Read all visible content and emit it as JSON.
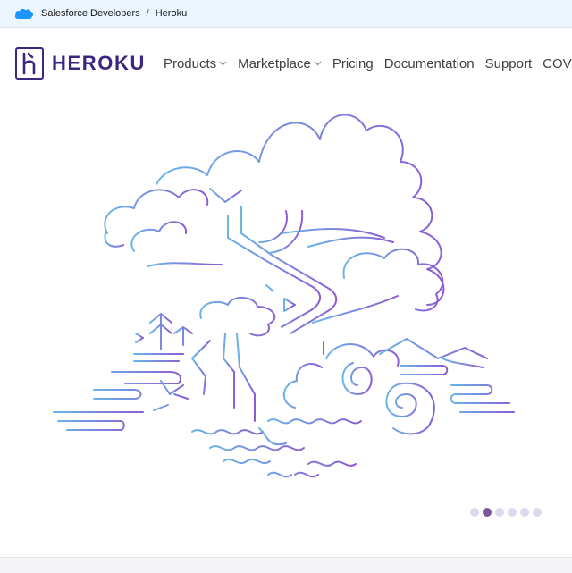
{
  "topbar": {
    "brand_icon": "salesforce-cloud-icon",
    "crumbs": [
      "Salesforce Developers",
      "Heroku"
    ],
    "separator": "/"
  },
  "nav": {
    "logo_text": "HEROKU",
    "items": [
      {
        "label": "Products",
        "has_dropdown": true
      },
      {
        "label": "Marketplace",
        "has_dropdown": true
      },
      {
        "label": "Pricing",
        "has_dropdown": false
      },
      {
        "label": "Documentation",
        "has_dropdown": false
      },
      {
        "label": "Support",
        "has_dropdown": false
      },
      {
        "label": "COVI",
        "has_dropdown": false
      }
    ]
  },
  "carousel": {
    "slide_count": 6,
    "active_index": 1
  },
  "colors": {
    "brand": "#3b2780",
    "topbar_bg": "#eaf5fe",
    "art_blue": "#6bb4e6",
    "art_purple": "#8a5cd6",
    "dot_active": "#79589f",
    "dot_inactive": "#dcdaf0"
  }
}
